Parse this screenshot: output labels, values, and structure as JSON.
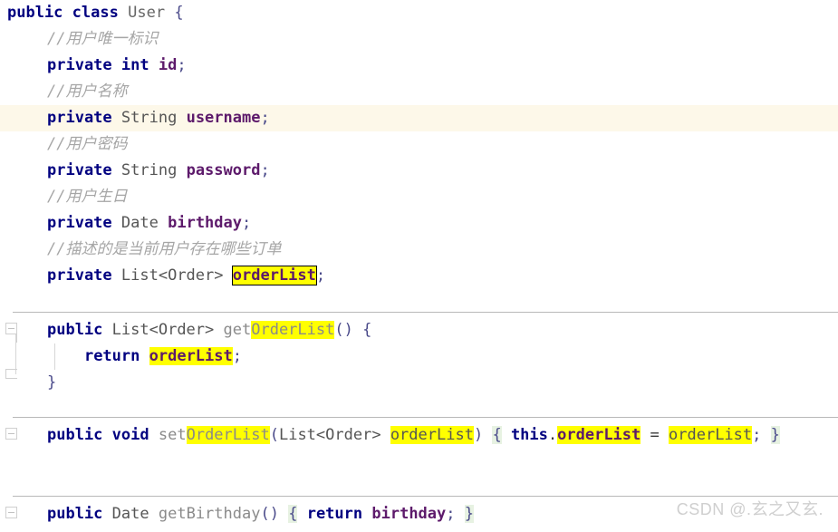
{
  "editor": {
    "language": "Java",
    "class_name": "User",
    "theme_colors": {
      "background": "#ffffff",
      "keyword": "#000080",
      "field": "#5d1a6b",
      "type": "#555555",
      "method": "#8a8a8a",
      "comment": "#a6a6a6",
      "search_highlight": "#ffff00",
      "caret_line": "#fdf8e9",
      "folded_brace": "#e7f2e2",
      "separator": "#b9b9b9"
    },
    "search_term": "orderList"
  },
  "lines": {
    "l1": {
      "kw_public": "public",
      "kw_class": "class",
      "name": "User",
      "brace": "{"
    },
    "l2": {
      "comment": "//用户唯一标识"
    },
    "l3": {
      "kw_private": "private",
      "kw_int": "int",
      "field": "id",
      "semi": ";"
    },
    "l4": {
      "comment": "//用户名称"
    },
    "l5": {
      "kw_private": "private",
      "type": "String",
      "field": "username",
      "semi": ";"
    },
    "l6": {
      "comment": "//用户密码"
    },
    "l7": {
      "kw_private": "private",
      "type": "String",
      "field": "password",
      "semi": ";"
    },
    "l8": {
      "comment": "//用户生日"
    },
    "l9": {
      "kw_private": "private",
      "type": "Date",
      "field": "birthday",
      "semi": ";"
    },
    "l10": {
      "comment": "//描述的是当前用户存在哪些订单"
    },
    "l11": {
      "kw_private": "private",
      "type": "List<Order>",
      "field": "orderList",
      "semi": ";"
    },
    "l12": {
      "kw_public": "public",
      "type": "List<Order>",
      "method_prefix": "get",
      "method_highlight": "OrderList",
      "parens": "()",
      "brace": "{"
    },
    "l13": {
      "kw_return": "return",
      "field": "orderList",
      "semi": ";"
    },
    "l14": {
      "brace_close": "}"
    },
    "l15": {
      "kw_public": "public",
      "kw_void": "void",
      "method_prefix": "set",
      "method_highlight": "OrderList",
      "paren_open": "(",
      "param_type": "List<Order>",
      "param_name": "orderList",
      "paren_close": ")",
      "brace_open": "{",
      "kw_this": "this",
      "dot": ".",
      "this_field": "orderList",
      "assign": "=",
      "value": "orderList",
      "semi": ";",
      "brace_close": "}"
    },
    "l16": {
      "kw_public": "public",
      "type": "Date",
      "method": "getBirthday",
      "parens": "()",
      "brace_open": "{",
      "kw_return": "return",
      "field": "birthday",
      "semi": ";",
      "brace_close": "}"
    }
  },
  "watermark": {
    "text": "CSDN @.玄之又玄."
  },
  "gutter": {
    "fold_markers": [
      {
        "name": "fold-getter-start",
        "state": "expanded"
      },
      {
        "name": "fold-getter-end",
        "state": "expanded-end"
      },
      {
        "name": "fold-setter",
        "state": "collapsed"
      },
      {
        "name": "fold-getbirthday",
        "state": "collapsed"
      }
    ]
  }
}
